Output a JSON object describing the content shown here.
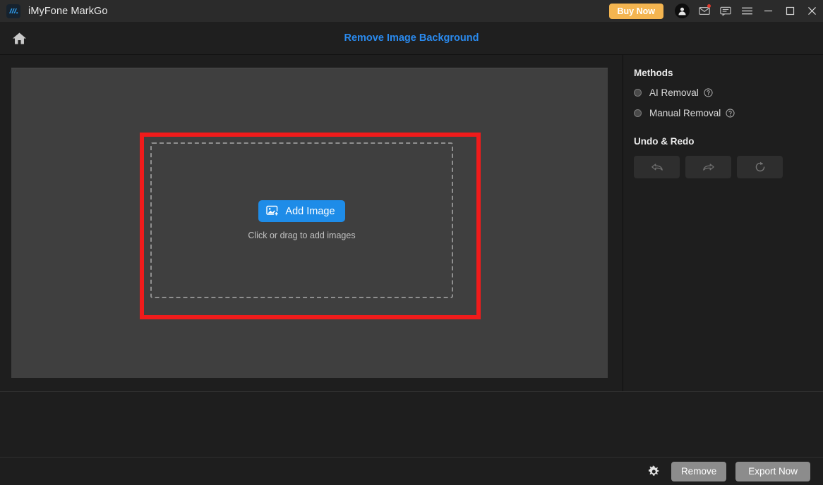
{
  "window": {
    "app_title": "iMyFone MarkGo",
    "logo_icon": "markgo-logo-icon",
    "buy_now_label": "Buy Now",
    "account_icon": "user-avatar-icon",
    "mail_icon": "mail-icon",
    "feedback_icon": "chat-bubble-icon",
    "menu_icon": "hamburger-menu-icon",
    "minimize_icon": "minimize-icon",
    "maximize_icon": "maximize-icon",
    "close_icon": "close-icon"
  },
  "nav": {
    "home_icon": "home-icon",
    "title": "Remove Image Background"
  },
  "canvas": {
    "add_image_label": "Add Image",
    "add_image_icon": "image-plus-icon",
    "hint": "Click or drag to add images",
    "highlight_color": "#f01b1b"
  },
  "methods": {
    "heading": "Methods",
    "options": [
      {
        "label": "AI Removal",
        "selected": false,
        "help_icon": "help-circle-icon"
      },
      {
        "label": "Manual Removal",
        "selected": false,
        "help_icon": "help-circle-icon"
      }
    ]
  },
  "undo_redo": {
    "heading": "Undo & Redo",
    "buttons": [
      {
        "name": "undo-button",
        "icon": "undo-arrow-icon"
      },
      {
        "name": "redo-button",
        "icon": "redo-arrow-icon"
      },
      {
        "name": "reset-button",
        "icon": "refresh-icon"
      }
    ]
  },
  "footer": {
    "settings_icon": "gear-icon",
    "remove_label": "Remove",
    "export_label": "Export Now"
  },
  "colors": {
    "accent_blue": "#1e8ce8",
    "nav_title_blue": "#2a8aee",
    "buy_now_orange": "#f4b550",
    "highlight_red": "#f01b1b",
    "window_bg": "#1e1e1e",
    "canvas_bg": "#3f3f3f"
  }
}
